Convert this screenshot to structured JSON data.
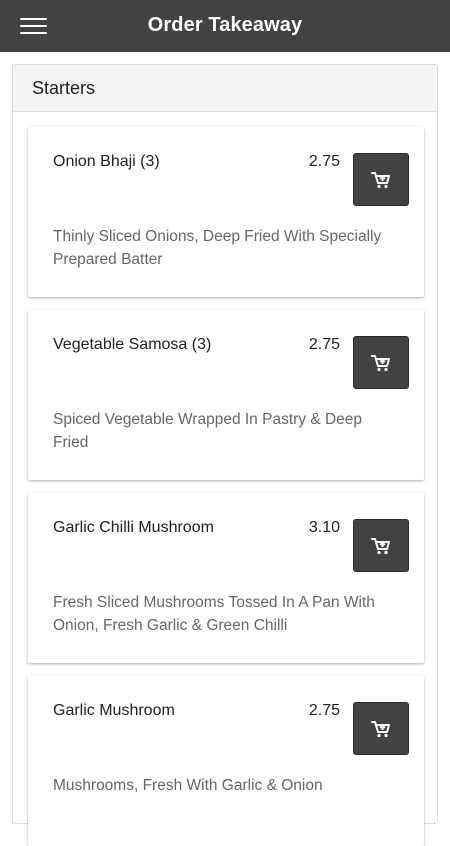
{
  "header": {
    "title": "Order Takeaway",
    "menu_icon": "hamburger-menu-icon"
  },
  "section": {
    "title": "Starters"
  },
  "colors": {
    "app_bar": "#424242",
    "cart_button": "#424242",
    "description_text": "#666666"
  },
  "items": [
    {
      "name": "Onion Bhaji (3)",
      "price": "2.75",
      "description": "Thinly Sliced Onions, Deep Fried With Specially Prepared Batter",
      "icon": "add-to-cart-icon"
    },
    {
      "name": "Vegetable Samosa (3)",
      "price": "2.75",
      "description": "Spiced Vegetable Wrapped In Pastry & Deep Fried",
      "icon": "add-to-cart-icon"
    },
    {
      "name": "Garlic Chilli Mushroom",
      "price": "3.10",
      "description": "Fresh Sliced Mushrooms Tossed In A Pan With Onion, Fresh Garlic & Green Chilli",
      "icon": "add-to-cart-icon"
    },
    {
      "name": "Garlic Mushroom",
      "price": "2.75",
      "description": "Mushrooms, Fresh With Garlic & Onion",
      "icon": "add-to-cart-icon"
    }
  ]
}
